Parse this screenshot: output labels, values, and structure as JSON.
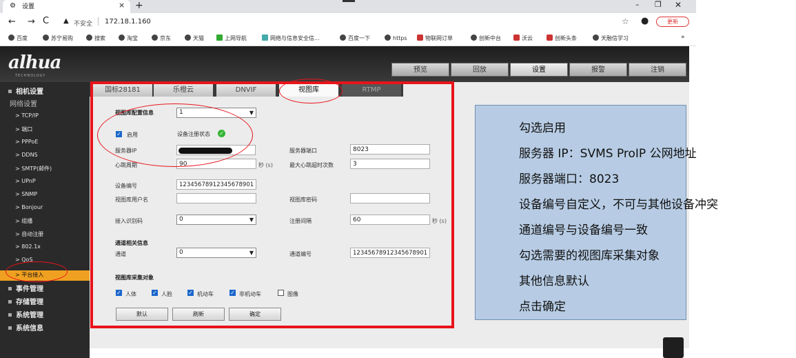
{
  "browser": {
    "tab_title": "设置",
    "tab_close": "×",
    "new_tab": "+",
    "window_controls": {
      "minimize": "–",
      "maximize": "❐",
      "close": "✕"
    },
    "nav": {
      "back": "←",
      "forward": "→",
      "reload": "C"
    },
    "insecure_label": "不安全",
    "url": "172.18.1.160",
    "update_label": "更新",
    "bookmarks": [
      "百度",
      "苏宁易购",
      "搜索",
      "淘宝",
      "京东",
      "天猫",
      "上网导航",
      "网络与信息安全信...",
      "百度一下",
      "https",
      "物联网订单",
      "创新中台",
      "沃云",
      "创新头条",
      "天融信学习"
    ],
    "bookmarks_more": "»"
  },
  "app": {
    "logo": "alhua",
    "logo_sub": "TECHNOLOGY",
    "nav_tabs": [
      "预览",
      "回放",
      "设置",
      "报警",
      "注销"
    ],
    "active_nav": "设置"
  },
  "sidebar": {
    "camera_settings": "相机设置",
    "network_settings": "网络设置",
    "items": [
      "TCP/IP",
      "端口",
      "PPPoE",
      "DDNS",
      "SMTP(邮件)",
      "UPnP",
      "SNMP",
      "Bonjour",
      "组播",
      "自动注册",
      "802.1x",
      "QoS",
      "平台接入"
    ],
    "event_mgmt": "事件管理",
    "storage_mgmt": "存储管理",
    "system_mgmt": "系统管理",
    "system_info": "系统信息"
  },
  "subtabs": [
    "国标28181",
    "乐橙云",
    "DNVIF",
    "视图库",
    "RTMP"
  ],
  "form": {
    "config_info_label": "视图库配置信息",
    "config_value": "1",
    "enable_label": "启用",
    "reg_status_label": "设备注册状态",
    "server_ip_label": "服务器IP",
    "server_port_label": "服务器端口",
    "server_port_value": "8023",
    "heartbeat_label": "心跳周期",
    "heartbeat_value": "90",
    "heartbeat_unit": "秒 (s)",
    "max_timeout_label": "最大心跳超时次数",
    "max_timeout_value": "3",
    "device_id_label": "设备编号",
    "device_id_value": "12345678912345678901",
    "username_label": "视图库用户名",
    "password_label": "视图库密码",
    "access_code_label": "接入识别码",
    "access_code_value": "0",
    "reg_interval_label": "注册间隔",
    "reg_interval_value": "60",
    "reg_interval_unit": "秒 (s)",
    "channel_info_label": "通道相关信息",
    "channel_label": "通道",
    "channel_value": "0",
    "channel_id_label": "通道编号",
    "channel_id_value": "12345678912345678901",
    "collect_label": "视图库采集对象",
    "collect_items": [
      "人体",
      "人脸",
      "机动车",
      "非机动车",
      "图像"
    ],
    "buttons": {
      "default": "默认",
      "refresh": "刷新",
      "ok": "确定"
    }
  },
  "note": {
    "lines": [
      "勾选启用",
      "服务器 IP：SVMS ProIP 公网地址",
      "服务器端口：8023",
      "设备编号自定义，不可与其他设备冲突",
      "通道编号与设备编号一致",
      "勾选需要的视图库采集对象",
      "其他信息默认",
      "点击确定"
    ]
  },
  "colors": {
    "annotation_red": "#e8141a",
    "note_bg": "#b7cce4",
    "active_sidebar": "#f0a020",
    "checkbox_blue": "#1a66cc"
  },
  "checkboxes": {
    "enable": true,
    "collect_states": [
      true,
      true,
      true,
      true,
      false
    ]
  }
}
